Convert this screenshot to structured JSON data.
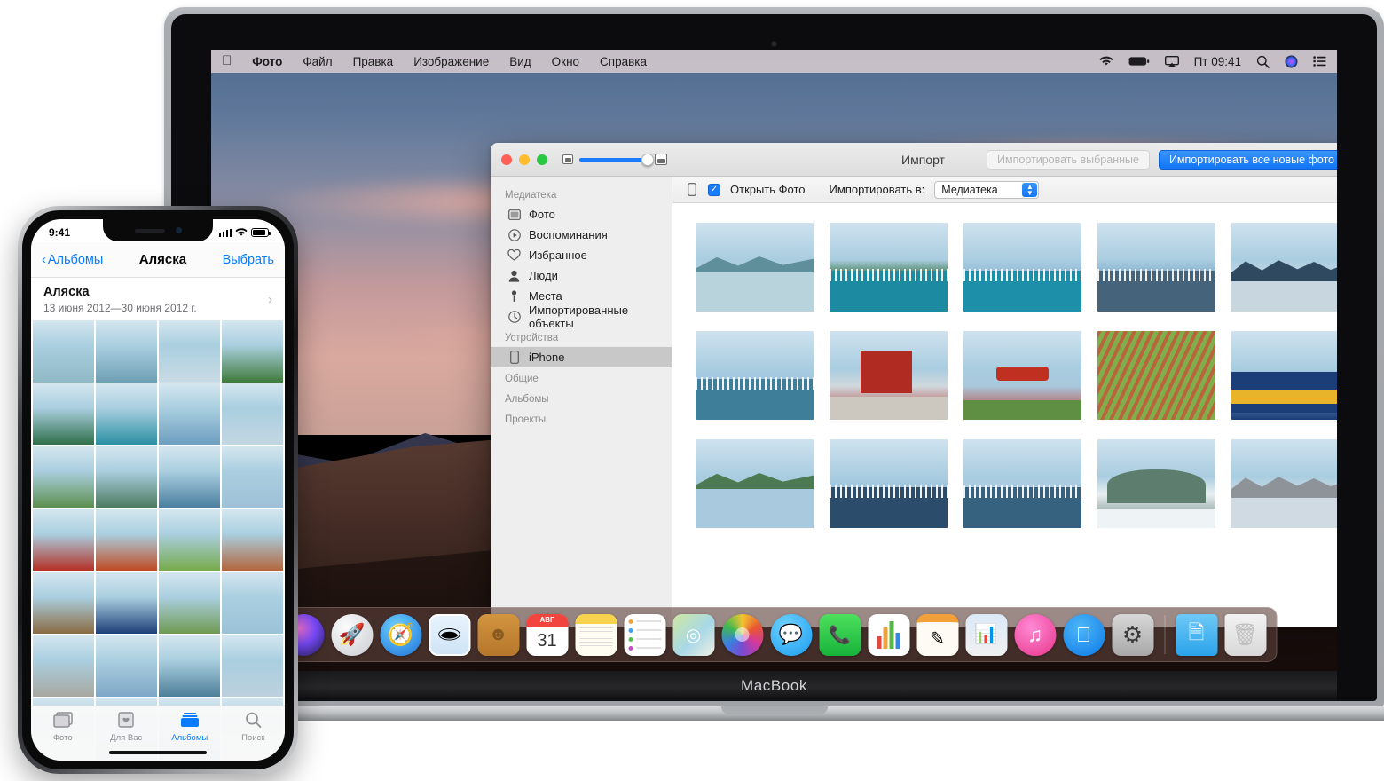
{
  "device": {
    "macbook_label": "MacBook"
  },
  "menubar": {
    "apple": "apple-logo",
    "items": [
      "Фото",
      "Файл",
      "Правка",
      "Изображение",
      "Вид",
      "Окно",
      "Справка"
    ],
    "status": {
      "wifi": "wifi-icon",
      "battery": "battery-icon",
      "airplay": "airplay-icon",
      "clock": "Пт 09:41",
      "search": "search-icon",
      "siri": "siri-icon",
      "controls": "control-center-icon"
    }
  },
  "window": {
    "title": "Импорт",
    "traffic": [
      "close",
      "minimize",
      "zoom"
    ],
    "zoom_slider": {
      "min_icon": "small-thumbnail-icon",
      "max_icon": "large-thumbnail-icon",
      "value": 78
    },
    "import_selected_label": "Импортировать выбранные",
    "import_all_label": "Импортировать все новые фото",
    "sidebar": {
      "sections": [
        {
          "header": "Медиатека",
          "items": [
            {
              "label": "Фото",
              "icon": "photos-icon"
            },
            {
              "label": "Воспоминания",
              "icon": "memories-icon"
            },
            {
              "label": "Избранное",
              "icon": "heart-icon"
            },
            {
              "label": "Люди",
              "icon": "person-icon"
            },
            {
              "label": "Места",
              "icon": "pin-icon"
            },
            {
              "label": "Импортированные объекты",
              "icon": "clock-icon"
            }
          ]
        },
        {
          "header": "Устройства",
          "items": [
            {
              "label": "iPhone",
              "icon": "iphone-icon",
              "selected": true
            }
          ]
        },
        {
          "header": "Общие",
          "items": []
        },
        {
          "header": "Альбомы",
          "items": []
        },
        {
          "header": "Проекты",
          "items": []
        }
      ]
    },
    "import_bar": {
      "device_icon": "iphone-icon",
      "open_photos_label": "Открыть Фото",
      "open_photos_checked": true,
      "import_to_label": "Импортировать в:",
      "import_to_value": "Медиатека"
    },
    "photo_grid": {
      "rows": [
        [
          {
            "alt": "lake-mountains-reflection",
            "c1": "#b9d3dd",
            "c2": "#5f8f9a",
            "kind": "lake"
          },
          {
            "alt": "dock-with-boats",
            "c1": "#2f6f3a",
            "c2": "#1c8aa0",
            "kind": "dock"
          },
          {
            "alt": "harbor-house-pier",
            "c1": "#8fb8d8",
            "c2": "#1d8fa8",
            "kind": "pier"
          },
          {
            "alt": "marina-masts",
            "c1": "#7fa9cd",
            "c2": "#45637b",
            "kind": "marina"
          },
          {
            "alt": "snowy-mountain-range",
            "c1": "#c8d6e0",
            "c2": "#2f4a60",
            "kind": "snow"
          }
        ],
        [
          {
            "alt": "marina-boats-clouds",
            "c1": "#9ec3de",
            "c2": "#3f7e98",
            "kind": "marina"
          },
          {
            "alt": "red-house-on-stilts",
            "c1": "#cfd8dd",
            "c2": "#b02b22",
            "kind": "redhouse"
          },
          {
            "alt": "red-seaplane-on-water",
            "c1": "#a9c8dc",
            "c2": "#c03020",
            "kind": "plane"
          },
          {
            "alt": "red-green-tundra-plants",
            "c1": "#7fae4a",
            "c2": "#b9643c",
            "kind": "plants"
          },
          {
            "alt": "alaska-railroad-train",
            "c1": "#8fb4d2",
            "c2": "#1b3d78",
            "kind": "train"
          }
        ],
        [
          {
            "alt": "coast-with-tree-branch",
            "c1": "#a9cade",
            "c2": "#4c7a52",
            "kind": "coast"
          },
          {
            "alt": "harbor-marina-wide",
            "c1": "#9cc0dd",
            "c2": "#2b4d6b",
            "kind": "marina"
          },
          {
            "alt": "boats-in-harbor",
            "c1": "#aecbe2",
            "c2": "#36617f",
            "kind": "marina"
          },
          {
            "alt": "green-mountain-sea",
            "c1": "#e8eef2",
            "c2": "#5d7d6e",
            "kind": "mount"
          },
          {
            "alt": "rocky-beach-mountains",
            "c1": "#cfdae2",
            "c2": "#8e9299",
            "kind": "beach"
          }
        ]
      ]
    }
  },
  "iphone": {
    "status": {
      "time": "9:41",
      "signal": "signal-bars-icon",
      "wifi": "wifi-icon",
      "battery": "battery-icon"
    },
    "nav": {
      "back_label": "Альбомы",
      "title": "Аляска",
      "action_label": "Выбрать"
    },
    "album": {
      "name": "Аляска",
      "date_range": "13 июня 2012—30 июня 2012 г."
    },
    "grid_colors": [
      "#8fb9c4",
      "#6f9fb4",
      "#c9dbe4",
      "#3f7a3a",
      "#2f6f4a",
      "#2a8fa2",
      "#6d9ec0",
      "#c3d6e2",
      "#5c8f4e",
      "#4c7a5e",
      "#4a7fa0",
      "#9fc0d6",
      "#b43026",
      "#c04a22",
      "#77ab4a",
      "#b3653c",
      "#8a6a42",
      "#1d3f78",
      "#6f9a52",
      "#9cc2d8",
      "#a8a8a0",
      "#7fa7c6",
      "#4c7e98",
      "#bcd0dd",
      "#cfd8de",
      "#9ab4c4",
      "#6f93ab",
      "#dde6ec"
    ],
    "tabs": [
      {
        "label": "Фото",
        "icon": "photos-icon",
        "selected": false
      },
      {
        "label": "Для Вас",
        "icon": "foryou-icon",
        "selected": false
      },
      {
        "label": "Альбомы",
        "icon": "albums-icon",
        "selected": true
      },
      {
        "label": "Поиск",
        "icon": "search-icon",
        "selected": false
      }
    ]
  },
  "dock": {
    "items": [
      {
        "name": "siri",
        "label": "Siri"
      },
      {
        "name": "launchpad",
        "label": "Launchpad"
      },
      {
        "name": "safari",
        "label": "Safari"
      },
      {
        "name": "mail",
        "label": "Mail"
      },
      {
        "name": "contacts",
        "label": "Contacts"
      },
      {
        "name": "calendar",
        "label": "Calendar",
        "month": "АВГ",
        "day": "31"
      },
      {
        "name": "notes",
        "label": "Notes"
      },
      {
        "name": "reminders",
        "label": "Reminders"
      },
      {
        "name": "maps",
        "label": "Maps"
      },
      {
        "name": "photos",
        "label": "Photos"
      },
      {
        "name": "messages",
        "label": "Messages"
      },
      {
        "name": "facetime",
        "label": "FaceTime"
      },
      {
        "name": "numbers",
        "label": "Numbers"
      },
      {
        "name": "pages",
        "label": "Pages"
      },
      {
        "name": "keynote",
        "label": "Keynote"
      },
      {
        "name": "itunes",
        "label": "iTunes"
      },
      {
        "name": "appstore",
        "label": "App Store"
      },
      {
        "name": "systempreferences",
        "label": "System Preferences"
      },
      {
        "name": "documents-folder",
        "label": "Documents"
      },
      {
        "name": "trash",
        "label": "Trash"
      }
    ]
  },
  "colors": {
    "accent": "#1a7bfb",
    "ios_blue": "#0a7cff",
    "sidebar_bg": "#eeeeee"
  }
}
